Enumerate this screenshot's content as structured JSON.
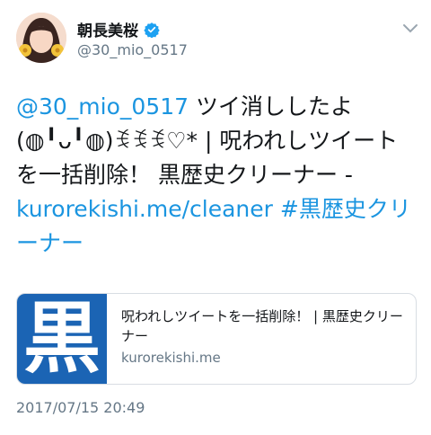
{
  "user": {
    "display_name": "朝長美桜",
    "handle": "@30_mio_0517",
    "verified": true
  },
  "tweet": {
    "mention": "@30_mio_0517",
    "text_part1": " ツイ消ししたよ(◍╹ᴗ╹◍)ꉂꉂꉂ♡* | 呪われしツイートを一括削除！ 黒歴史クリーナー - ",
    "url": "kurorekishi.me/cleaner",
    "space": " ",
    "hashtag": "#黒歴史クリーナー"
  },
  "card": {
    "thumb_glyph": "黒",
    "title": "呪われしツイートを一括削除！ | 黒歴史クリーナー",
    "domain": "kurorekishi.me"
  },
  "timestamp": "2017/07/15 20:49",
  "icons": {
    "verified": "verified-badge-icon",
    "menu": "chevron-down-icon"
  },
  "colors": {
    "link": "#1b95e0",
    "muted": "#657786",
    "card_thumb": "#1b64b4"
  }
}
